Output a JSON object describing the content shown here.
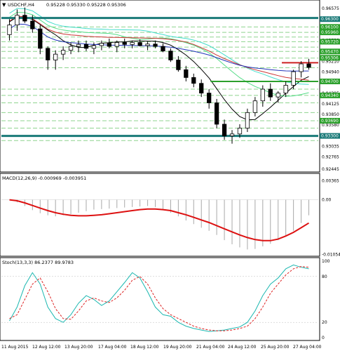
{
  "header": {
    "symbol_timeframe": "USDCHF,H4",
    "ohlc": "0.95228 0.95330 0.95228 0.95306"
  },
  "colors": {
    "bull": "#ffffff",
    "bear": "#000000",
    "level_teal": "#1a7a78",
    "level_green": "#2ca02c",
    "level_red": "#cc2222",
    "grid": "#8fd48f",
    "ma_black": "#000000",
    "ma_red": "#cc3333",
    "ma_blue": "#2233bb",
    "ma_green": "#55dd88",
    "ma_cyan": "#44ddcc",
    "macd_hist": "#a8a8a8",
    "macd_signal": "#dd1111",
    "stoch_main": "#1ab7b0",
    "stoch_signal": "#dd2222",
    "price_label_bg": "#2ca02c"
  },
  "chart_data": [
    {
      "type": "candlestick",
      "title": "USDCHF,H4",
      "ylim": [
        0.92445,
        0.96575
      ],
      "y_labels": [
        "0.96575",
        "0.96300",
        "0.96030",
        "0.95755",
        "0.95485",
        "0.95210",
        "0.94940",
        "0.94665",
        "0.94395",
        "0.94125",
        "0.93850",
        "0.93580",
        "0.93310",
        "0.93035",
        "0.92765",
        "0.92445"
      ],
      "price_labels": [
        {
          "value": "0.96300",
          "color": "#1a7a78"
        },
        {
          "value": "0.96100",
          "color": "#2ca02c"
        },
        {
          "value": "0.95960",
          "color": "#2ca02c"
        },
        {
          "value": "0.95720",
          "color": "#2ca02c"
        },
        {
          "value": "0.95470",
          "color": "#2ca02c"
        },
        {
          "value": "0.95306",
          "color": "#2ca02c"
        },
        {
          "value": "0.94700",
          "color": "#2ca02c"
        },
        {
          "value": "0.94340",
          "color": "#2ca02c"
        },
        {
          "value": "0.93690",
          "color": "#2ca02c"
        },
        {
          "value": "0.93300",
          "color": "#1a7a78"
        }
      ],
      "levels": [
        {
          "value": 0.9633,
          "color_key": "level_teal",
          "x_from": 0.0
        },
        {
          "value": 0.933,
          "color_key": "level_teal",
          "x_from": 0.0
        },
        {
          "value": 0.947,
          "color_key": "level_green",
          "x_from": 0.66
        },
        {
          "value": 0.9518,
          "color_key": "level_red",
          "x_from": 0.885
        }
      ],
      "gridlines": [
        0.961,
        0.9596,
        0.9584,
        0.9572,
        0.9558,
        0.9547,
        0.953,
        0.9505,
        0.945,
        0.9434,
        0.9415,
        0.939,
        0.9369,
        0.935,
        0.9318
      ],
      "candles": [
        [
          0.959,
          0.963,
          0.9575,
          0.9615
        ],
        [
          0.9615,
          0.9655,
          0.96,
          0.964
        ],
        [
          0.964,
          0.966,
          0.962,
          0.9625
        ],
        [
          0.9625,
          0.964,
          0.9595,
          0.9605
        ],
        [
          0.9605,
          0.9615,
          0.954,
          0.9555
        ],
        [
          0.9555,
          0.956,
          0.95,
          0.9525
        ],
        [
          0.9525,
          0.955,
          0.95,
          0.954
        ],
        [
          0.954,
          0.956,
          0.9525,
          0.955
        ],
        [
          0.955,
          0.957,
          0.954,
          0.956
        ],
        [
          0.956,
          0.9575,
          0.9545,
          0.9565
        ],
        [
          0.9565,
          0.9575,
          0.9548,
          0.9555
        ],
        [
          0.9555,
          0.957,
          0.954,
          0.9562
        ],
        [
          0.9562,
          0.9575,
          0.955,
          0.9568
        ],
        [
          0.9568,
          0.958,
          0.9555,
          0.956
        ],
        [
          0.956,
          0.9575,
          0.9545,
          0.957
        ],
        [
          0.957,
          0.958,
          0.9555,
          0.9565
        ],
        [
          0.9565,
          0.9575,
          0.9555,
          0.957
        ],
        [
          0.957,
          0.9578,
          0.956,
          0.9562
        ],
        [
          0.9562,
          0.9572,
          0.955,
          0.9566
        ],
        [
          0.9566,
          0.9575,
          0.9555,
          0.956
        ],
        [
          0.956,
          0.9568,
          0.9545,
          0.9548
        ],
        [
          0.9548,
          0.9555,
          0.952,
          0.9525
        ],
        [
          0.9525,
          0.9535,
          0.9495,
          0.95
        ],
        [
          0.95,
          0.951,
          0.947,
          0.948
        ],
        [
          0.948,
          0.949,
          0.9455,
          0.9465
        ],
        [
          0.9465,
          0.9475,
          0.943,
          0.944
        ],
        [
          0.944,
          0.945,
          0.94,
          0.9415
        ],
        [
          0.9415,
          0.9425,
          0.935,
          0.936
        ],
        [
          0.936,
          0.9372,
          0.932,
          0.933
        ],
        [
          0.933,
          0.9345,
          0.931,
          0.9335
        ],
        [
          0.9335,
          0.936,
          0.9325,
          0.935
        ],
        [
          0.935,
          0.94,
          0.934,
          0.939
        ],
        [
          0.939,
          0.943,
          0.938,
          0.942
        ],
        [
          0.942,
          0.946,
          0.9405,
          0.945
        ],
        [
          0.945,
          0.9465,
          0.942,
          0.943
        ],
        [
          0.943,
          0.9445,
          0.9415,
          0.944
        ],
        [
          0.944,
          0.947,
          0.943,
          0.946
        ],
        [
          0.946,
          0.95,
          0.945,
          0.9495
        ],
        [
          0.9495,
          0.9522,
          0.948,
          0.9515
        ],
        [
          0.9515,
          0.9528,
          0.95,
          0.9506
        ]
      ]
    },
    {
      "type": "bar",
      "title": "MACD(12,26,9) -0.000969 -0.003951",
      "ylim": [
        -0.0105,
        0.0036
      ],
      "y_labels": [
        "0.00365",
        "0.00",
        "-0.010546"
      ],
      "histogram": [
        0.0,
        -0.0005,
        -0.0012,
        -0.002,
        -0.0026,
        -0.003,
        -0.0032,
        -0.003,
        -0.0028,
        -0.0025,
        -0.0022,
        -0.0019,
        -0.0018,
        -0.0017,
        -0.0016,
        -0.0015,
        -0.0014,
        -0.0013,
        -0.0012,
        -0.0014,
        -0.0018,
        -0.0025,
        -0.0032,
        -0.004,
        -0.0047,
        -0.0054,
        -0.006,
        -0.0068,
        -0.0078,
        -0.0086,
        -0.0092,
        -0.0096,
        -0.0095,
        -0.009,
        -0.0085,
        -0.0078,
        -0.007,
        -0.006,
        -0.0045,
        -0.003
      ],
      "signal": [
        0.0,
        -0.0002,
        -0.0006,
        -0.0011,
        -0.0016,
        -0.0021,
        -0.0025,
        -0.0028,
        -0.003,
        -0.0031,
        -0.0031,
        -0.003,
        -0.0029,
        -0.0027,
        -0.0025,
        -0.0023,
        -0.0021,
        -0.0019,
        -0.0018,
        -0.0018,
        -0.0019,
        -0.0021,
        -0.0025,
        -0.0029,
        -0.0034,
        -0.0039,
        -0.0044,
        -0.005,
        -0.0056,
        -0.0062,
        -0.0068,
        -0.0073,
        -0.0077,
        -0.0079,
        -0.0079,
        -0.0076,
        -0.007,
        -0.0063,
        -0.0054,
        -0.0045
      ]
    },
    {
      "type": "line",
      "title": "Stoch(13,3,3) 86.2377 89.9783",
      "ylim": [
        0,
        100
      ],
      "y_labels": [
        "100",
        "80",
        "20",
        "0"
      ],
      "series": [
        {
          "color_key": "stoch_main",
          "values": [
            22,
            40,
            68,
            85,
            70,
            40,
            25,
            20,
            30,
            45,
            55,
            50,
            42,
            48,
            60,
            72,
            85,
            78,
            60,
            40,
            30,
            28,
            20,
            15,
            12,
            10,
            8,
            9,
            10,
            12,
            14,
            20,
            35,
            55,
            70,
            78,
            90,
            95,
            92,
            90
          ]
        },
        {
          "color_key": "stoch_signal",
          "values": [
            25,
            30,
            50,
            70,
            78,
            60,
            38,
            25,
            24,
            35,
            48,
            52,
            48,
            46,
            52,
            62,
            75,
            80,
            70,
            52,
            38,
            30,
            25,
            20,
            15,
            12,
            10,
            9,
            9,
            10,
            12,
            15,
            25,
            40,
            58,
            70,
            82,
            90,
            93,
            92
          ]
        }
      ]
    }
  ],
  "x_axis_labels": [
    "11 Aug 2015",
    "12 Aug 12:00",
    "13 Aug 20:00",
    "17 Aug 04:00",
    "18 Aug 12:00",
    "19 Aug 20:00",
    "21 Aug 04:00",
    "24 Aug 12:00",
    "25 Aug 20:00",
    "27 Aug 04:00"
  ]
}
